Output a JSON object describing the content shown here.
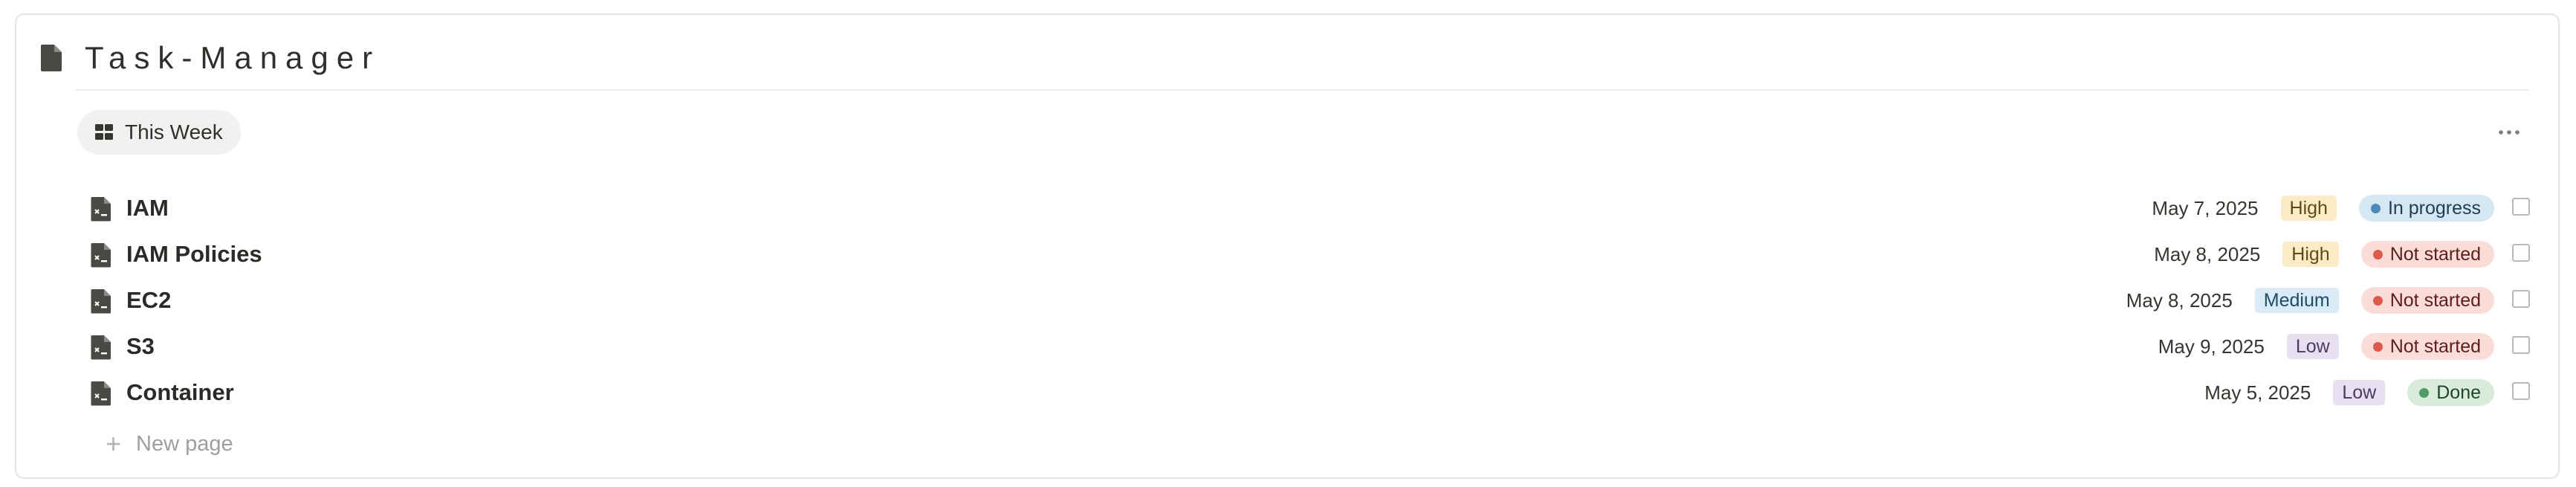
{
  "page": {
    "title": "Task-Manager",
    "icon": "document-icon"
  },
  "view": {
    "tab_label": "This Week",
    "tab_icon": "board-grid-icon",
    "more_label": "···"
  },
  "rows": [
    {
      "name": "IAM",
      "date": "May 7, 2025",
      "priority": "High",
      "status": "In progress"
    },
    {
      "name": "IAM Policies",
      "date": "May 8, 2025",
      "priority": "High",
      "status": "Not started"
    },
    {
      "name": "EC2",
      "date": "May 8, 2025",
      "priority": "Medium",
      "status": "Not started"
    },
    {
      "name": "S3",
      "date": "May 9, 2025",
      "priority": "Low",
      "status": "Not started"
    },
    {
      "name": "Container",
      "date": "May 5, 2025",
      "priority": "Low",
      "status": "Done"
    }
  ],
  "new_page": {
    "label": "New page"
  },
  "colors": {
    "high_tag": "#fbecc6",
    "medium_tag": "#d8ebf6",
    "low_tag": "#e8dff0",
    "in_progress": "#d5e7f3",
    "not_started": "#fadcd8",
    "done": "#d9ecdc"
  }
}
